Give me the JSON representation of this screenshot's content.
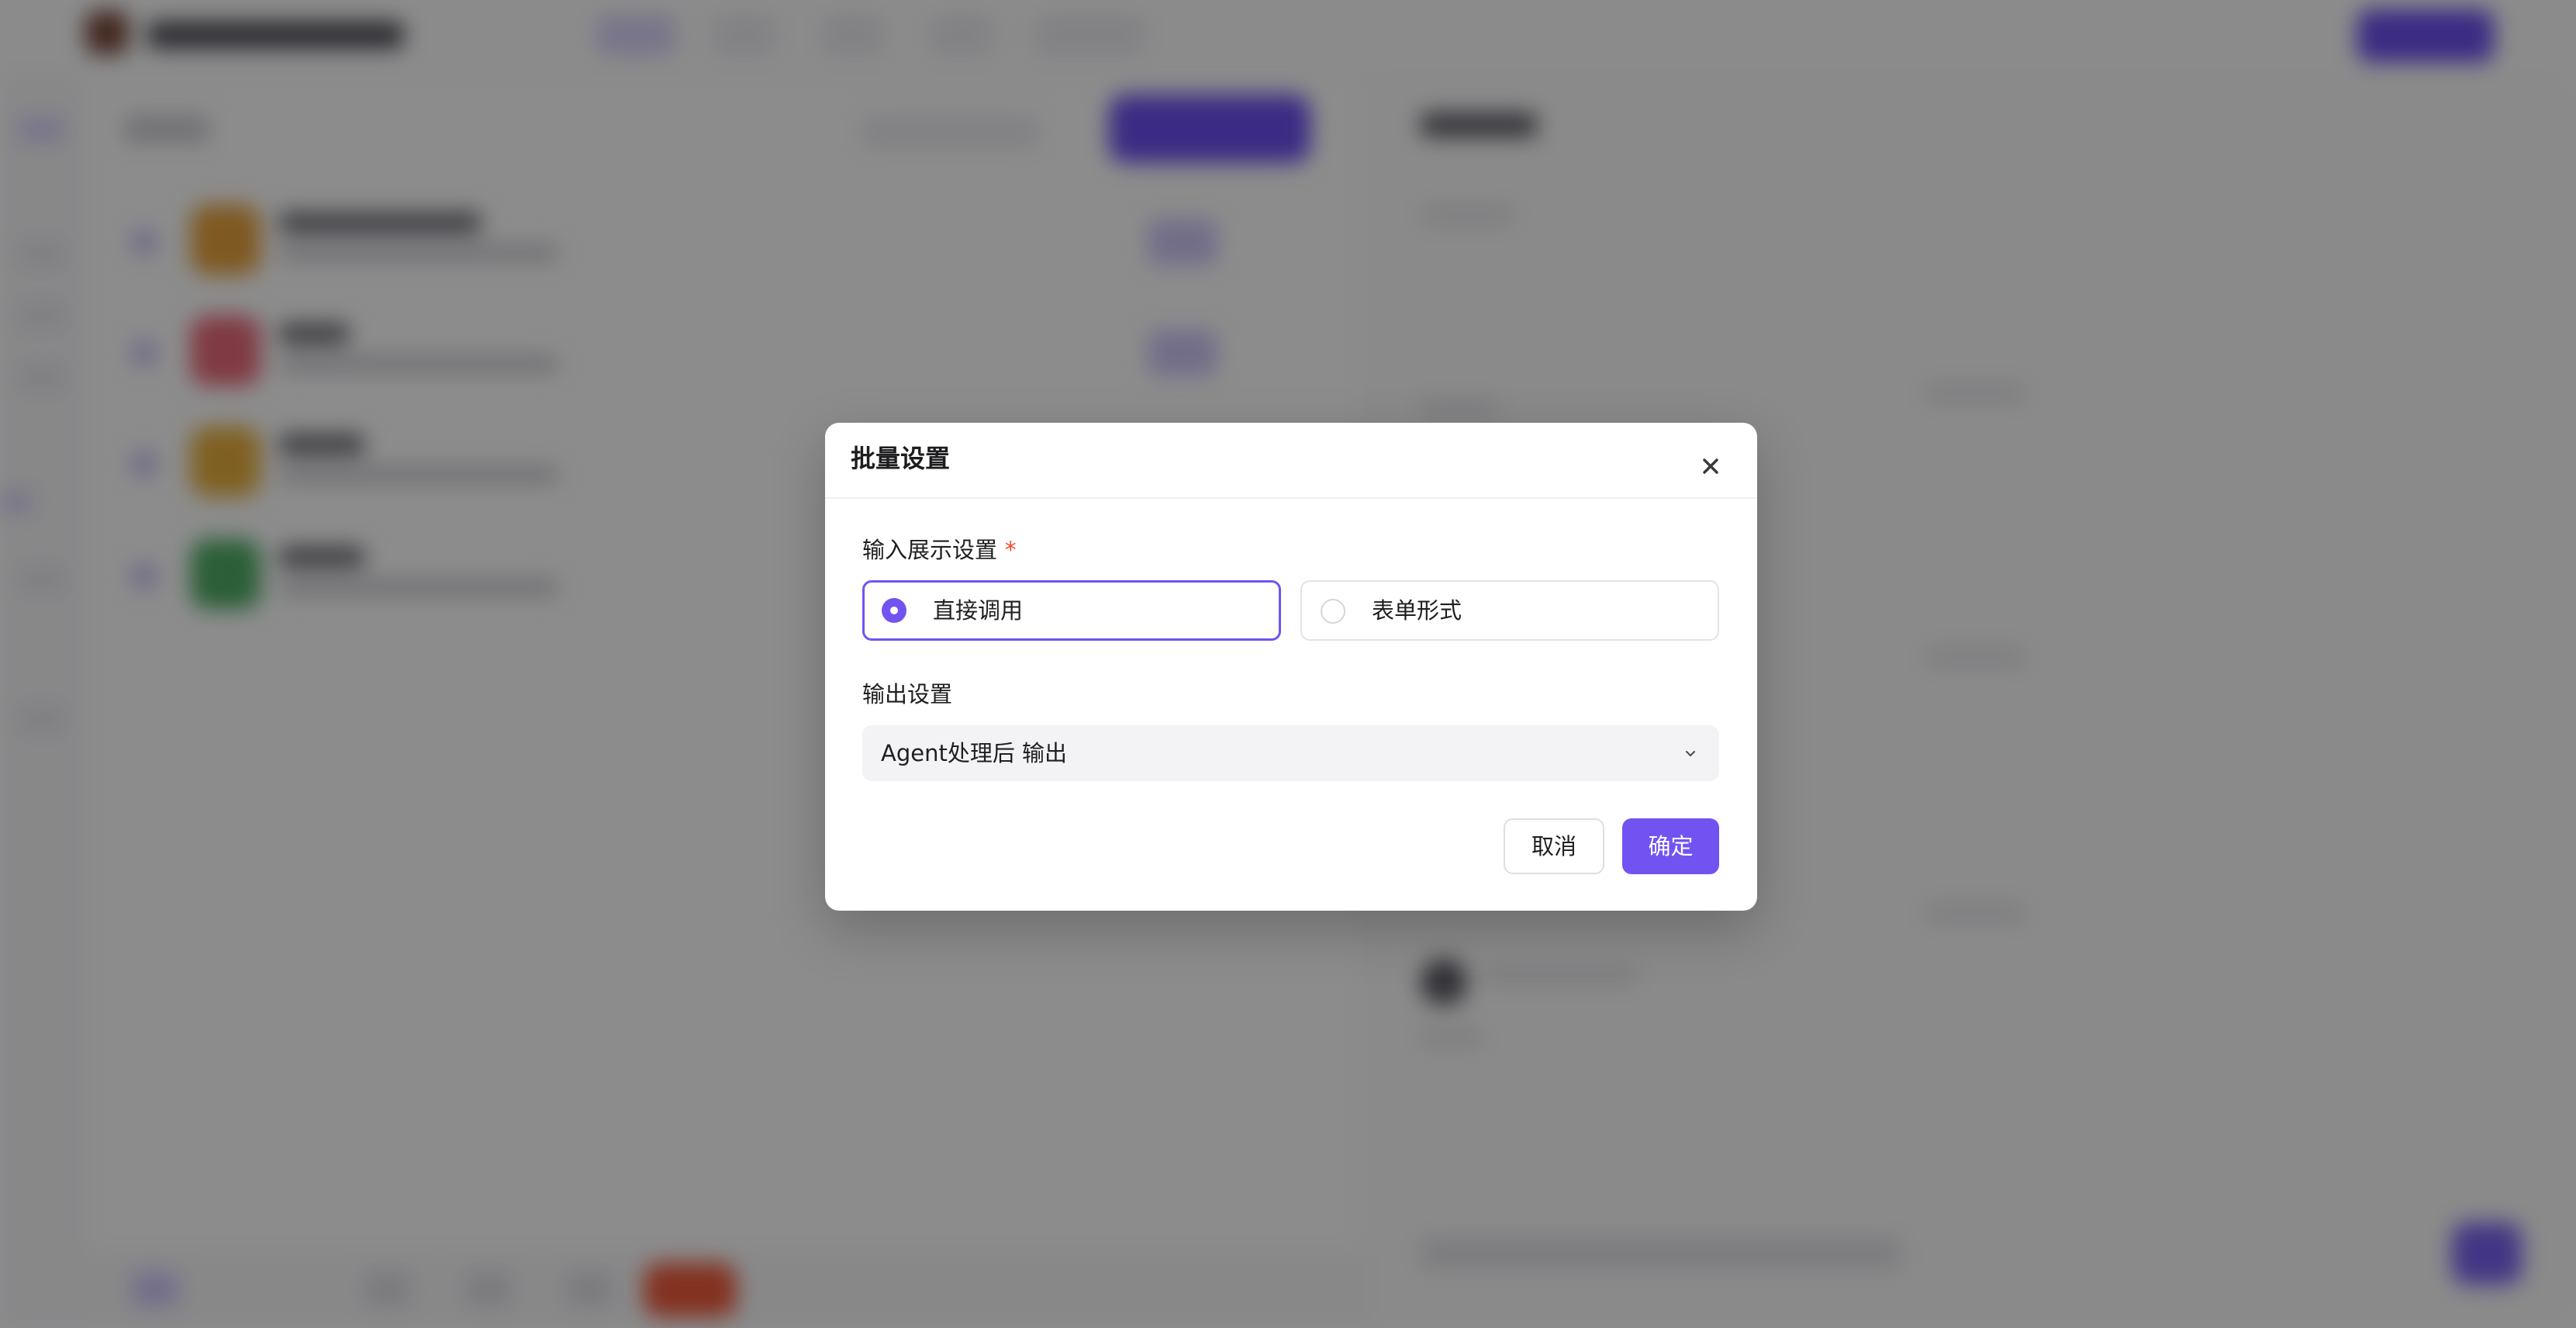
{
  "colors": {
    "accent": "#7253F2",
    "required_star": "#F5462D",
    "overlay": "rgba(0,0,0,0.45)",
    "select_background": "#F3F3F6"
  },
  "modal": {
    "title": "批量设置",
    "close_icon": "close-icon",
    "input_display": {
      "label": "输入展示设置",
      "required_mark": "*",
      "options": [
        {
          "label": "直接调用",
          "selected": true
        },
        {
          "label": "表单形式",
          "selected": false
        }
      ]
    },
    "output": {
      "label": "输出设置",
      "selected_value": "Agent处理后 输出",
      "chevron_icon": "chevron-down-icon"
    },
    "buttons": {
      "cancel": "取消",
      "confirm": "确定"
    }
  }
}
